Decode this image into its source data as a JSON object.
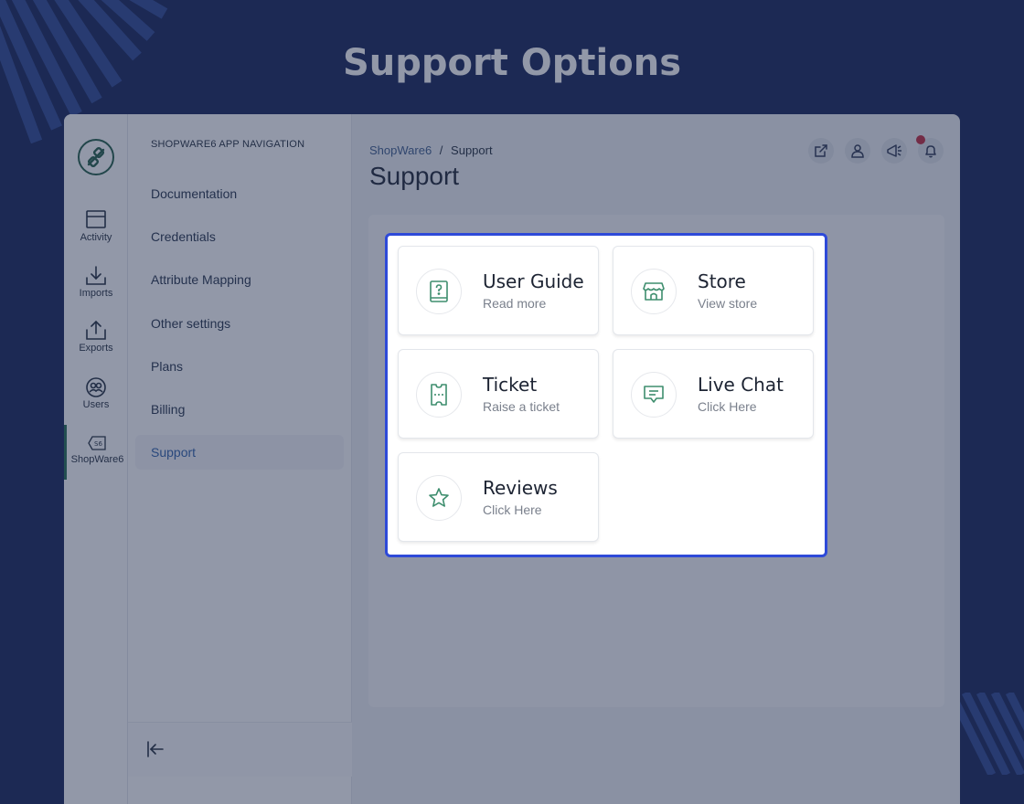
{
  "hero": {
    "title": "Support Options"
  },
  "rail": {
    "items": [
      {
        "label": "Activity",
        "icon": "calendar-icon"
      },
      {
        "label": "Imports",
        "icon": "download-icon"
      },
      {
        "label": "Exports",
        "icon": "upload-icon"
      },
      {
        "label": "Users",
        "icon": "users-icon"
      },
      {
        "label": "ShopWare6",
        "icon": "shopware-icon"
      }
    ]
  },
  "nav": {
    "heading": "SHOPWARE6 APP NAVIGATION",
    "items": [
      {
        "label": "Documentation"
      },
      {
        "label": "Credentials"
      },
      {
        "label": "Attribute Mapping"
      },
      {
        "label": "Other settings"
      },
      {
        "label": "Plans"
      },
      {
        "label": "Billing"
      },
      {
        "label": "Support"
      }
    ],
    "active": "Support"
  },
  "header": {
    "breadcrumb": {
      "parent": "ShopWare6",
      "separator": "/",
      "current": "Support"
    },
    "title": "Support"
  },
  "cards": [
    {
      "title": "User Guide",
      "subtitle": "Read more",
      "icon": "book-question-icon"
    },
    {
      "title": "Store",
      "subtitle": "View store",
      "icon": "store-icon"
    },
    {
      "title": "Ticket",
      "subtitle": "Raise a ticket",
      "icon": "ticket-icon"
    },
    {
      "title": "Live Chat",
      "subtitle": "Click Here",
      "icon": "chat-icon"
    },
    {
      "title": "Reviews",
      "subtitle": "Click Here",
      "icon": "star-icon"
    }
  ],
  "colors": {
    "background": "#122056",
    "highlight_border": "#2e4ad8",
    "icon_accent": "#3e8e6e",
    "notification": "#c0263b"
  }
}
